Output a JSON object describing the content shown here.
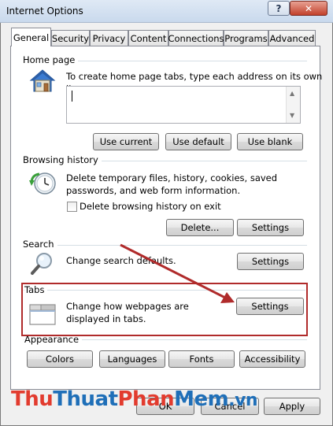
{
  "window": {
    "title": "Internet Options",
    "help_label": "?",
    "close_label": "✕"
  },
  "tabs": [
    "General",
    "Security",
    "Privacy",
    "Content",
    "Connections",
    "Programs",
    "Advanced"
  ],
  "home_page": {
    "label": "Home page",
    "description": "To create home page tabs, type each address on its own line.",
    "url_value": "",
    "use_current": "Use current",
    "use_default": "Use default",
    "use_blank": "Use blank"
  },
  "browsing_history": {
    "label": "Browsing history",
    "description": "Delete temporary files, history, cookies, saved passwords, and web form information.",
    "delete_on_exit": "Delete browsing history on exit",
    "delete_on_exit_checked": false,
    "delete_button": "Delete...",
    "settings_button": "Settings"
  },
  "search": {
    "label": "Search",
    "description": "Change search defaults.",
    "settings_button": "Settings"
  },
  "tabs_section": {
    "label": "Tabs",
    "description": "Change how webpages are displayed in tabs.",
    "settings_button": "Settings"
  },
  "appearance": {
    "label": "Appearance",
    "buttons": [
      "Colors",
      "Languages",
      "Fonts",
      "Accessibility"
    ]
  },
  "footer": {
    "ok": "OK",
    "cancel": "Cancel",
    "apply": "Apply"
  },
  "watermark": {
    "part1": "Thu",
    "part2": "Thuat",
    "part3": "Phan",
    "part4": "Mem",
    "part5": ".vn"
  },
  "colors": {
    "highlight": "#b02b2b",
    "arrow": "#b02b2b"
  }
}
